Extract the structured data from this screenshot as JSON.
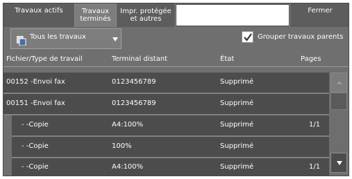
{
  "tabs": [
    {
      "label": "Travaux actifs"
    },
    {
      "label": "Travaux\nterminés"
    },
    {
      "label": "Impr. protégée\net autres"
    }
  ],
  "close_label": "Fermer",
  "filter": {
    "selected": "Tous les travaux"
  },
  "group_checkbox": {
    "label": "Grouper travaux parents",
    "checked": true
  },
  "columns": {
    "file_type": "Fichier/Type de travail",
    "remote": "Terminal distant",
    "status": "État",
    "pages": "Pages"
  },
  "rows": [
    {
      "file_type": "00152 -Envoi fax",
      "remote": "0123456789",
      "status": "Supprimé",
      "pages": ""
    },
    {
      "file_type": "00151 -Envoi fax",
      "remote": "0123456789",
      "status": "Supprimé",
      "pages": ""
    },
    {
      "file_type": "- -Copie",
      "remote": "A4:100%",
      "status": "Supprimé",
      "pages": "1/1"
    },
    {
      "file_type": "- -Copie",
      "remote": "100%",
      "status": "Supprimé",
      "pages": ""
    },
    {
      "file_type": "- -Copie",
      "remote": "A4:100%",
      "status": "Supprimé",
      "pages": "1/1"
    }
  ],
  "icons": {
    "filter": "document-stack-icon",
    "checkbox": "checkmark-icon",
    "scroll_up": "arrow-up-icon",
    "scroll_down": "arrow-down-icon"
  }
}
